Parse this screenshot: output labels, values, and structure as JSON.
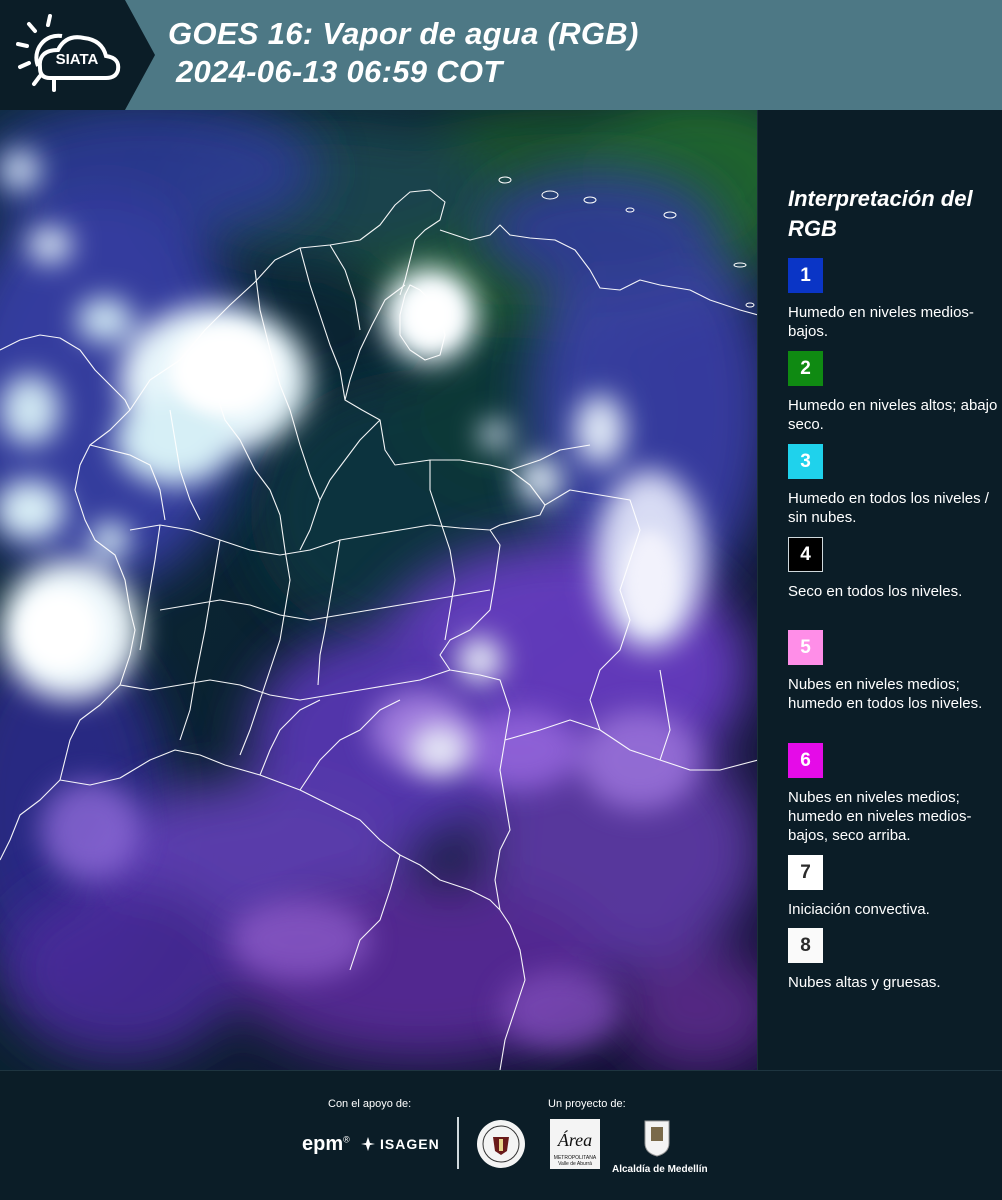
{
  "header": {
    "logo_text": "SIATA",
    "title_line1": "GOES 16: Vapor de agua (RGB)",
    "title_line2": "2024-06-13 06:59 COT",
    "bg_color": "#4d7885"
  },
  "legend": {
    "title": "Interpretación del RGB",
    "items": [
      {
        "number": "1",
        "color": "#0a35c6",
        "text_color": "#ffffff",
        "description": "Humedo en niveles medios-bajos."
      },
      {
        "number": "2",
        "color": "#0f8a12",
        "text_color": "#ffffff",
        "description": "Humedo en niveles altos; abajo seco."
      },
      {
        "number": "3",
        "color": "#1fd2ec",
        "text_color": "#ffffff",
        "description": "Humedo en todos los niveles / sin nubes."
      },
      {
        "number": "4",
        "color": "#000000",
        "text_color": "#ffffff",
        "description": "Seco en todos los niveles."
      },
      {
        "number": "5",
        "color": "#ff8ee8",
        "text_color": "#ffffff",
        "description": "Nubes en niveles medios; humedo en todos los niveles."
      },
      {
        "number": "6",
        "color": "#e50be8",
        "text_color": "#ffffff",
        "description": "Nubes en niveles medios; humedo en niveles medios-bajos, seco arriba."
      },
      {
        "number": "7",
        "color": "#ffffff",
        "text_color": "#2b2b2b",
        "description": "Iniciación convectiva."
      },
      {
        "number": "8",
        "color": "#fafafa",
        "text_color": "#2b2b2b",
        "description": "Nubes altas y gruesas."
      }
    ]
  },
  "footer": {
    "support_label": "Con el apoyo de:",
    "project_label": "Un proyecto de:",
    "sponsor_1": "epm",
    "sponsor_1_mark": "®",
    "sponsor_2": "ISAGEN",
    "partner_1": "METROPOLITANA Valle de Aburrá",
    "partner_1_script": "Área",
    "partner_2": "Alcaldía de Medellín"
  }
}
